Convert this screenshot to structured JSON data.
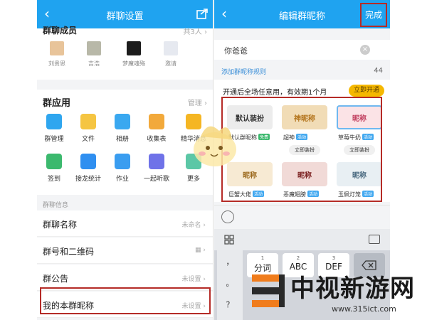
{
  "left": {
    "nav_title": "群聊设置",
    "members_title": "群聊成员",
    "members_count": "共3人",
    "members": [
      {
        "name": "刘贵思",
        "color": "#e8c49a"
      },
      {
        "name": "吉浩",
        "color": "#b8b8a8"
      },
      {
        "name": "梦魔魂殇",
        "color": "#1c1c1c"
      },
      {
        "name": "邀请",
        "color": "#e6e9f0"
      }
    ],
    "apps_title": "群应用",
    "apps_manage": "管理",
    "apps": [
      {
        "label": "群管理",
        "color": "#2fa6ef"
      },
      {
        "label": "文件",
        "color": "#f5c542"
      },
      {
        "label": "相册",
        "color": "#3aa8f0"
      },
      {
        "label": "收集表",
        "color": "#f2a93b"
      },
      {
        "label": "精华消息",
        "color": "#f5b623"
      },
      {
        "label": "签到",
        "color": "#3cb96e"
      },
      {
        "label": "接龙统计",
        "color": "#2f8ff0"
      },
      {
        "label": "作业",
        "color": "#3a9df0"
      },
      {
        "label": "一起听歌",
        "color": "#6f72e8"
      },
      {
        "label": "更多",
        "color": "#5cc7a6"
      }
    ],
    "section_label": "群聊信息",
    "rows": [
      {
        "label": "群聊名称",
        "value": "未命名"
      },
      {
        "label": "群号和二维码",
        "value": ""
      },
      {
        "label": "群公告",
        "value": "未设置"
      },
      {
        "label": "我的本群昵称",
        "value": "未设置"
      }
    ]
  },
  "right": {
    "nav_title": "编辑群昵称",
    "done": "完成",
    "nick_value": "你爸爸",
    "rule_link": "添加群昵称规则",
    "rule_count": "44",
    "promo_text": "开通后全场任意用，有效期1个月",
    "promo_button": "立即开通",
    "tiles": [
      {
        "text": "默认装扮",
        "label": "默认群昵称",
        "badge": "免费",
        "badge_color": "#3cb96e",
        "bg": "#ececec",
        "fg": "#333",
        "button": ""
      },
      {
        "text": "神昵称",
        "label": "超神",
        "badge": "活动",
        "badge_color": "#41a8f0",
        "bg": "#f1dcb6",
        "fg": "#b3741b",
        "button": "立即装扮"
      },
      {
        "text": "昵称",
        "label": "草莓牛奶",
        "badge": "活动",
        "badge_color": "#41a8f0",
        "bg": "#fbe3e6",
        "fg": "#c24060",
        "button": "立即装扮"
      },
      {
        "text": "昵称",
        "label": "巨蟹大佬",
        "badge": "活动",
        "badge_color": "#41a8f0",
        "bg": "#f7ead3",
        "fg": "#9c6a1e",
        "button": ""
      },
      {
        "text": "昵称",
        "label": "恶魔翅膀",
        "badge": "活动",
        "badge_color": "#41a8f0",
        "bg": "#f1dad7",
        "fg": "#7a1f1f",
        "button": ""
      },
      {
        "text": "昵称",
        "label": "玉佩灯笼",
        "badge": "活动",
        "badge_color": "#41a8f0",
        "bg": "#e8eff3",
        "fg": "#4a6a80",
        "button": ""
      }
    ],
    "keyboard": {
      "punct": [
        "，",
        "。",
        "？"
      ],
      "keys": [
        {
          "num": "1",
          "text": "分词"
        },
        {
          "num": "2",
          "text": "ABC"
        },
        {
          "num": "3",
          "text": "DEF"
        }
      ]
    }
  },
  "watermark": {
    "text": "中视新游网",
    "url": "www.315ict.com"
  }
}
